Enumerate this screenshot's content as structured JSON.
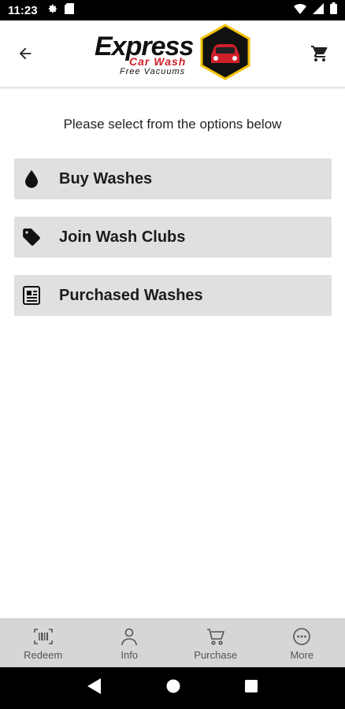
{
  "status_bar": {
    "time": "11:23",
    "left_icons": [
      "gear-icon",
      "sd-card-icon"
    ],
    "right_icons": [
      "wifi-icon",
      "signal-icon",
      "battery-icon"
    ]
  },
  "header": {
    "logo": {
      "line1": "Express",
      "line2": "Car Wash",
      "line3": "Free Vacuums"
    },
    "back_icon": "arrow-left-icon",
    "cart_icon": "cart-icon"
  },
  "main": {
    "subtitle": "Please select from the options below",
    "options": [
      {
        "label": "Buy Washes",
        "icon": "water-drop-icon"
      },
      {
        "label": "Join Wash Clubs",
        "icon": "tag-icon"
      },
      {
        "label": "Purchased Washes",
        "icon": "receipt-icon"
      }
    ]
  },
  "bottom_nav": {
    "items": [
      {
        "label": "Redeem",
        "icon": "barcode-scan-icon"
      },
      {
        "label": "Info",
        "icon": "person-icon"
      },
      {
        "label": "Purchase",
        "icon": "cart-icon"
      },
      {
        "label": "More",
        "icon": "more-circle-icon"
      }
    ]
  },
  "colors": {
    "option_bg": "#e0e0e0",
    "brand_red": "#d0202a",
    "badge_yellow": "#f2c200",
    "nav_bg": "#d6d6d6"
  }
}
